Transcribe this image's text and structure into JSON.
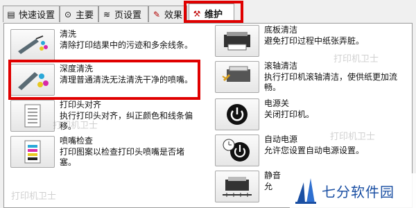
{
  "tabs": [
    {
      "label": "快速设置",
      "icon": "quick-setup-icon"
    },
    {
      "label": "主要",
      "icon": "main-settings-icon"
    },
    {
      "label": "页设置",
      "icon": "page-setup-icon"
    },
    {
      "label": "效果",
      "icon": "effects-icon"
    },
    {
      "label": "维护",
      "icon": "maintenance-icon"
    }
  ],
  "active_tab": "维护",
  "left_items": [
    {
      "title": "清洗",
      "desc": "清除打印结果中的污迹和多余线条。",
      "icon": "cleaning-icon"
    },
    {
      "title": "深度清洗",
      "desc": "清理普通清洗无法清洗干净的喷嘴。",
      "icon": "deep-cleaning-icon"
    },
    {
      "title": "打印头对齐",
      "desc": "执行打印头对齐，纠正颜色和线条偏移。",
      "icon": "print-head-alignment-icon"
    },
    {
      "title": "喷嘴检查",
      "desc": "打印图案以检查打印头喷嘴是否堵塞。",
      "icon": "nozzle-check-icon"
    }
  ],
  "right_items": [
    {
      "title": "底板清洁",
      "desc": "避免打印过程中纸张弄脏。",
      "icon": "bottom-plate-cleaning-icon"
    },
    {
      "title": "滚轴清洁",
      "desc": "执行打印机滚轴清洁，使供纸更加流畅。",
      "icon": "roller-cleaning-icon"
    },
    {
      "title": "电源关",
      "desc": "关闭打印机。",
      "icon": "power-off-icon"
    },
    {
      "title": "自动电源",
      "desc": "允许您设置自动电源设置。",
      "icon": "auto-power-icon"
    },
    {
      "title": "静音",
      "desc": "允",
      "icon": "quiet-mode-icon"
    }
  ],
  "watermarks": [
    "打印机卫士",
    "打印机卫士",
    "打印机卫士",
    "打印机卫士"
  ],
  "logo_text": "七分软件园",
  "highlight_color": "#e00000"
}
